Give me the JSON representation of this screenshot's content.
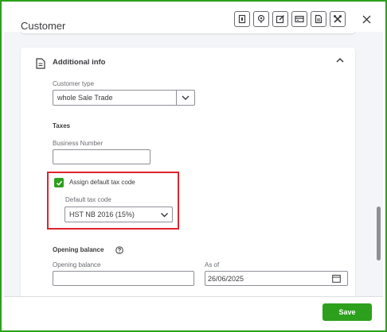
{
  "dialog": {
    "title": "Customer",
    "save_label": "Save"
  },
  "toolbar": {
    "icons": [
      "id-card-icon",
      "location-pin-icon",
      "edit-icon",
      "card-icon",
      "document-icon",
      "tools-icon"
    ],
    "close_icon": "close-icon"
  },
  "additional_info": {
    "title": "Additional info",
    "customer_type": {
      "label": "Customer type",
      "value": "whole Sale Trade"
    }
  },
  "taxes": {
    "heading": "Taxes",
    "business_number": {
      "label": "Business Number",
      "value": ""
    },
    "assign_default_tax_code": {
      "label": "Assign default tax code",
      "checked": true
    },
    "default_tax_code": {
      "label": "Default tax code",
      "value": "HST NB 2016 (15%)"
    }
  },
  "opening_balance": {
    "heading": "Opening balance",
    "amount_label": "Opening balance",
    "amount_value": "",
    "as_of_label": "As of",
    "as_of_value": "26/06/2025"
  },
  "colors": {
    "accent": "#2ca01c",
    "highlight": "#e0242a",
    "text": "#393a3d",
    "muted": "#6b6c72",
    "panel_bg": "#f4f5f8"
  }
}
